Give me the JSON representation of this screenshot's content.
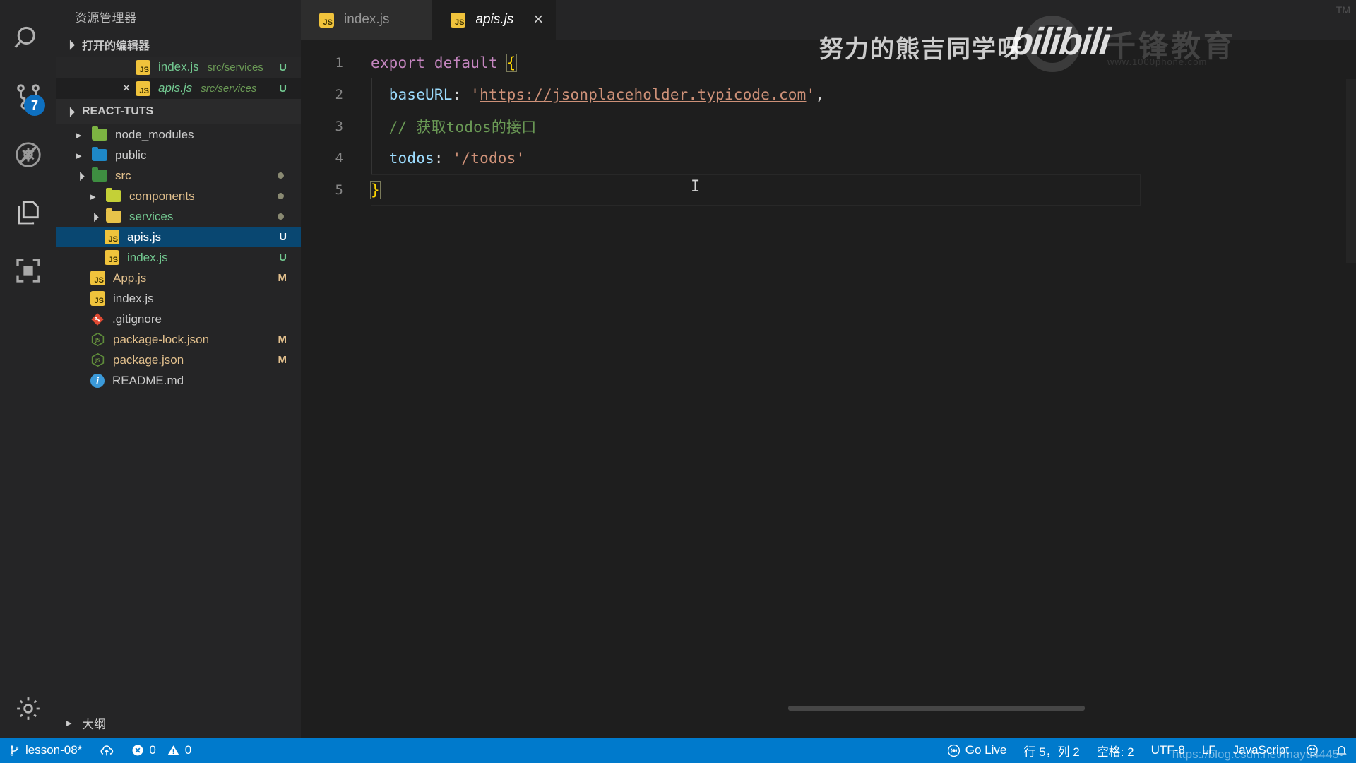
{
  "activitybar": {
    "items": [
      {
        "name": "search-icon",
        "label": "搜索"
      },
      {
        "name": "source-control-icon",
        "label": "源代码管理",
        "badge": "7"
      },
      {
        "name": "run-debug-disabled-icon",
        "label": "运行和调试"
      },
      {
        "name": "copy-files-icon",
        "label": "文件"
      },
      {
        "name": "remote-explorer-icon",
        "label": "远程资源管理器"
      },
      {
        "name": "settings-gear-icon",
        "label": "管理"
      }
    ]
  },
  "sidebar": {
    "title": "资源管理器",
    "open_editors": {
      "header": "打开的编辑器",
      "items": [
        {
          "name": "index.js",
          "path": "src/services",
          "status": "U",
          "italic": false,
          "closable": false
        },
        {
          "name": "apis.js",
          "path": "src/services",
          "status": "U",
          "italic": true,
          "closable": true
        }
      ]
    },
    "project": {
      "header": "REACT-TUTS",
      "tree": [
        {
          "label": "node_modules",
          "type": "folder",
          "icon": "folder-node-icon",
          "twisty": "right",
          "indent": 2,
          "color": "plain",
          "status": ""
        },
        {
          "label": "public",
          "type": "folder",
          "icon": "folder-public-icon",
          "twisty": "right",
          "indent": 2,
          "color": "plain",
          "status": ""
        },
        {
          "label": "src",
          "type": "folder",
          "icon": "folder-src-icon",
          "twisty": "down",
          "indent": 2,
          "color": "amber",
          "status": "dot"
        },
        {
          "label": "components",
          "type": "folder",
          "icon": "folder-components-icon",
          "twisty": "right",
          "indent": 3,
          "color": "amber",
          "status": "dot"
        },
        {
          "label": "services",
          "type": "folder",
          "icon": "folder-services-icon",
          "twisty": "down",
          "indent": 3,
          "color": "green",
          "status": "dot"
        },
        {
          "label": "apis.js",
          "type": "file",
          "icon": "js-file-icon",
          "twisty": "",
          "indent": 4,
          "color": "plain",
          "status": "U",
          "selected": true
        },
        {
          "label": "index.js",
          "type": "file",
          "icon": "js-file-icon",
          "twisty": "",
          "indent": 4,
          "color": "green",
          "status": "U"
        },
        {
          "label": "App.js",
          "type": "file",
          "icon": "js-file-icon",
          "twisty": "",
          "indent": 3,
          "color": "amber",
          "status": "M"
        },
        {
          "label": "index.js",
          "type": "file",
          "icon": "js-file-icon",
          "twisty": "",
          "indent": 3,
          "color": "plain",
          "status": ""
        },
        {
          "label": ".gitignore",
          "type": "file",
          "icon": "git-file-icon",
          "twisty": "",
          "indent": 3,
          "color": "plain",
          "status": ""
        },
        {
          "label": "package-lock.json",
          "type": "file",
          "icon": "npm-file-icon",
          "twisty": "",
          "indent": 3,
          "color": "amber",
          "status": "M"
        },
        {
          "label": "package.json",
          "type": "file",
          "icon": "npm-file-icon",
          "twisty": "",
          "indent": 3,
          "color": "amber",
          "status": "M"
        },
        {
          "label": "README.md",
          "type": "file",
          "icon": "markdown-info-icon",
          "twisty": "",
          "indent": 3,
          "color": "plain",
          "status": ""
        }
      ]
    },
    "outline": {
      "label": "大纲",
      "twisty": "right"
    }
  },
  "editor": {
    "tabs": [
      {
        "label": "index.js",
        "active": false,
        "closable": false,
        "italic": false
      },
      {
        "label": "apis.js",
        "active": true,
        "closable": true,
        "italic": true,
        "close_glyph": "×"
      }
    ],
    "lines": [
      {
        "num": "1",
        "tokens": [
          {
            "t": "export",
            "c": "kw"
          },
          {
            "t": " ",
            "c": "punc"
          },
          {
            "t": "default",
            "c": "kw"
          },
          {
            "t": " ",
            "c": "punc"
          },
          {
            "t": "{",
            "c": "brace-hl"
          }
        ]
      },
      {
        "num": "2",
        "tokens": [
          {
            "t": "  ",
            "c": "punc"
          },
          {
            "t": "baseURL",
            "c": "prop"
          },
          {
            "t": ": ",
            "c": "punc"
          },
          {
            "t": "'",
            "c": "str"
          },
          {
            "t": "https://jsonplaceholder.typicode.com",
            "c": "str link-underline"
          },
          {
            "t": "'",
            "c": "str"
          },
          {
            "t": ",",
            "c": "punc"
          }
        ]
      },
      {
        "num": "3",
        "tokens": [
          {
            "t": "  ",
            "c": "punc"
          },
          {
            "t": "// 获取todos的接口",
            "c": "cmt"
          }
        ]
      },
      {
        "num": "4",
        "tokens": [
          {
            "t": "  ",
            "c": "punc"
          },
          {
            "t": "todos",
            "c": "prop"
          },
          {
            "t": ": ",
            "c": "punc"
          },
          {
            "t": "'/todos'",
            "c": "str"
          }
        ]
      },
      {
        "num": "5",
        "tokens": [
          {
            "t": "}",
            "c": "brace-hl"
          }
        ]
      }
    ]
  },
  "statusbar": {
    "left": [
      {
        "name": "branch-status",
        "icon": "source-control-branch-icon",
        "label": "lesson-08*"
      },
      {
        "name": "sync-status",
        "icon": "cloud-upload-icon",
        "label": ""
      },
      {
        "name": "problems-status",
        "icon": "error-circle-icon",
        "label": "0"
      },
      {
        "name": "warnings-status",
        "icon": "warning-triangle-icon",
        "label": "0"
      }
    ],
    "right": [
      {
        "name": "go-live-status",
        "icon": "broadcast-icon",
        "label": "Go Live"
      },
      {
        "name": "cursor-position-status",
        "icon": "",
        "label": "行 5，列 2"
      },
      {
        "name": "indentation-status",
        "icon": "",
        "label": "空格: 2"
      },
      {
        "name": "encoding-status",
        "icon": "",
        "label": "UTF-8"
      },
      {
        "name": "eol-status",
        "icon": "",
        "label": "LF"
      },
      {
        "name": "language-mode-status",
        "icon": "",
        "label": "JavaScript"
      },
      {
        "name": "feedback-status",
        "icon": "smiley-icon",
        "label": ""
      },
      {
        "name": "notifications-status",
        "icon": "bell-icon",
        "label": ""
      }
    ]
  },
  "watermark": {
    "brand_cn": "千锋教育",
    "brand_sub": "www.1000phone.com",
    "tm": "TM",
    "uploader": "努力的熊吉同学呀",
    "platform": "bilibili",
    "bottom_url": "https://blog.csdn.net/mayu4445"
  },
  "colors": {
    "accent": "#007acc",
    "selection": "#094771",
    "badge": "#0e70c0",
    "modified": "#e2c08d",
    "untracked": "#73c991",
    "editor_bg": "#1e1e1e",
    "sidebar_bg": "#252526"
  }
}
